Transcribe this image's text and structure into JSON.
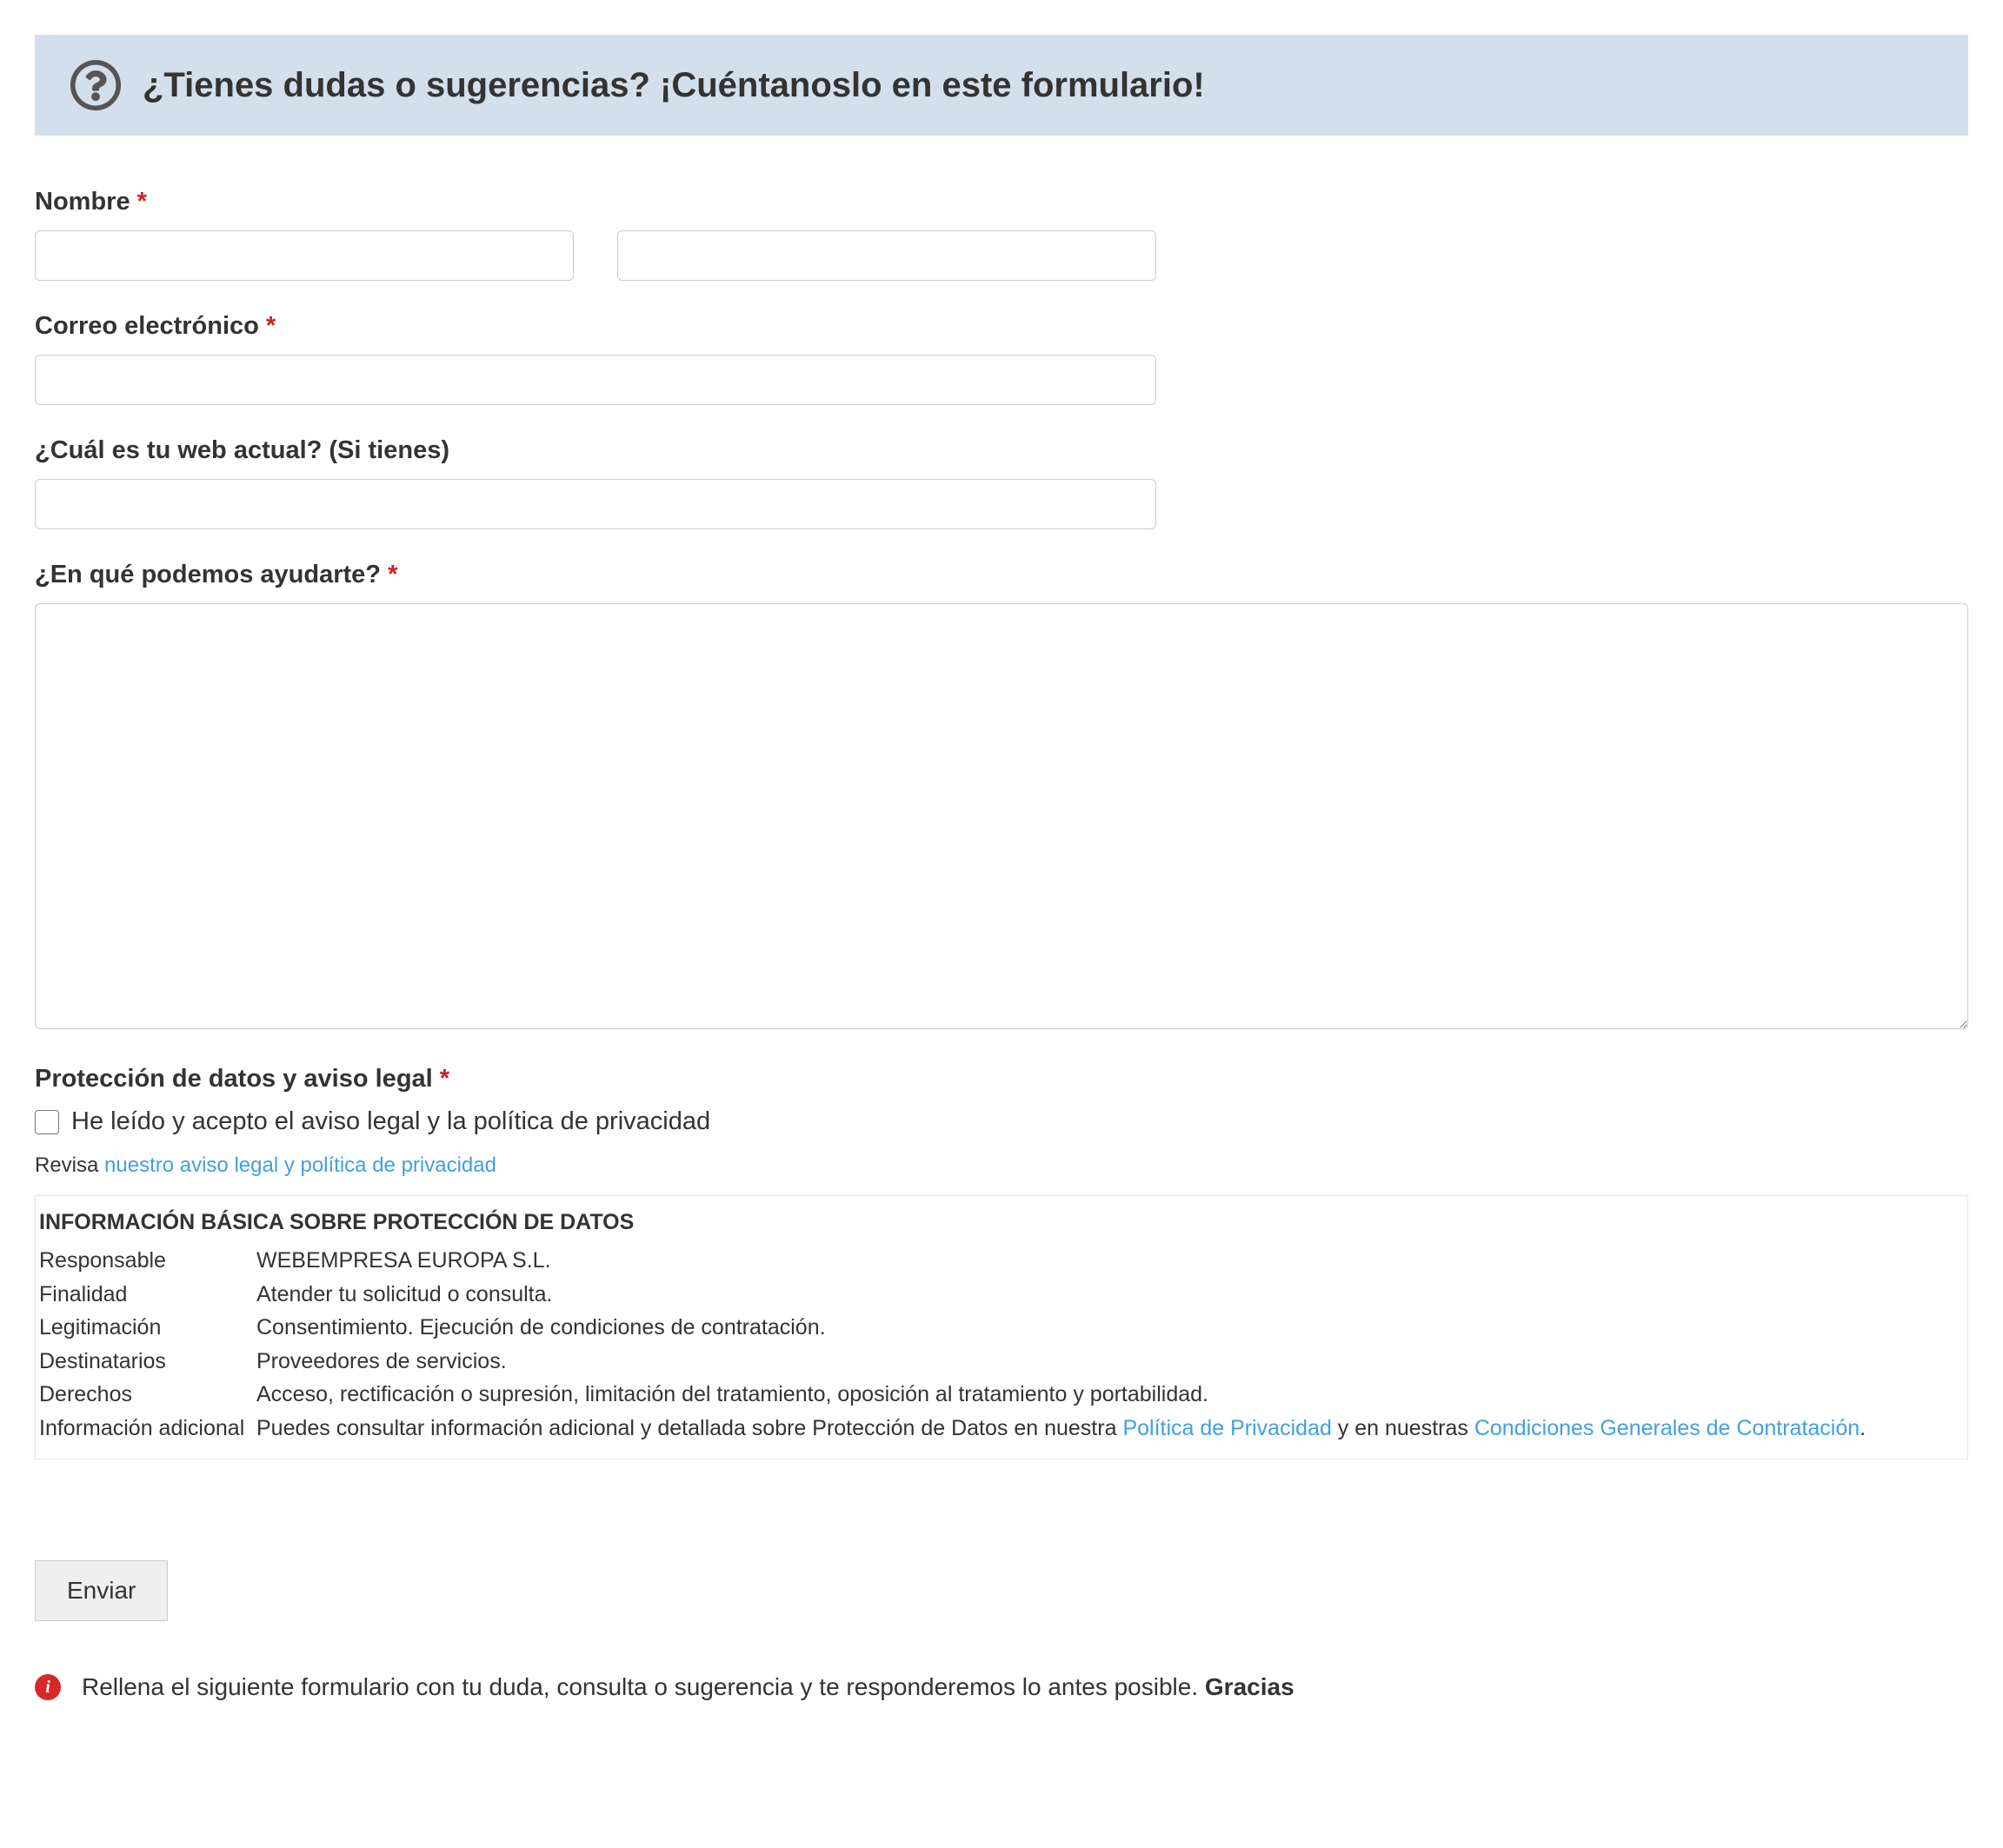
{
  "header": {
    "title": "¿Tienes dudas o sugerencias? ¡Cuéntanoslo en este formulario!"
  },
  "fields": {
    "name_label": "Nombre",
    "email_label": "Correo electrónico",
    "web_label": "¿Cuál es tu web actual? (Si tienes)",
    "help_label": "¿En qué podemos ayudarte?",
    "legal_label": "Protección de datos y aviso legal",
    "checkbox_label": "He leído y acepto el aviso legal y la política de privacidad",
    "review_prefix": "Revisa ",
    "review_link": "nuestro aviso legal y política de privacidad"
  },
  "info": {
    "heading": "INFORMACIÓN BÁSICA SOBRE PROTECCIÓN DE DATOS",
    "rows": [
      {
        "k": "Responsable",
        "v": "WEBEMPRESA EUROPA S.L."
      },
      {
        "k": "Finalidad",
        "v": "Atender tu solicitud o consulta."
      },
      {
        "k": "Legitimación",
        "v": "Consentimiento. Ejecución de condiciones de contratación."
      },
      {
        "k": "Destinatarios",
        "v": "Proveedores de servicios."
      },
      {
        "k": "Derechos",
        "v": "Acceso, rectificación o supresión, limitación del tratamiento, oposición al tratamiento y portabilidad."
      }
    ],
    "additional_key": "Información adicional",
    "additional_text1": "Puedes consultar información adicional y detallada sobre Protección de Datos en nuestra ",
    "additional_link1": "Política de Privacidad",
    "additional_text2": " y en nuestras ",
    "additional_link2": "Condiciones Generales de Contratación",
    "additional_text3": "."
  },
  "submit_label": "Enviar",
  "footer": {
    "text": "Rellena el siguiente formulario con tu duda, consulta o sugerencia y te responderemos lo antes posible. ",
    "bold": "Gracias"
  },
  "asterisk": "*"
}
